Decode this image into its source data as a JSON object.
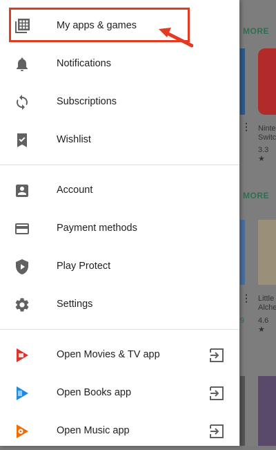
{
  "drawer": {
    "groups": [
      {
        "items": [
          {
            "label": "My apps & games",
            "icon": "apps-grid-icon"
          },
          {
            "label": "Notifications",
            "icon": "bell-icon"
          },
          {
            "label": "Subscriptions",
            "icon": "refresh-icon"
          },
          {
            "label": "Wishlist",
            "icon": "bookmark-check-icon"
          }
        ]
      },
      {
        "items": [
          {
            "label": "Account",
            "icon": "account-box-icon"
          },
          {
            "label": "Payment methods",
            "icon": "credit-card-icon"
          },
          {
            "label": "Play Protect",
            "icon": "shield-play-icon"
          },
          {
            "label": "Settings",
            "icon": "gear-icon"
          }
        ]
      },
      {
        "items": [
          {
            "label": "Open Movies & TV app",
            "icon": "play-movies-icon",
            "trailing_icon": "exit-to-app-icon"
          },
          {
            "label": "Open Books app",
            "icon": "play-books-icon",
            "trailing_icon": "exit-to-app-icon"
          },
          {
            "label": "Open Music app",
            "icon": "play-music-icon",
            "trailing_icon": "exit-to-app-icon"
          }
        ]
      }
    ]
  },
  "annotation": {
    "highlight_color": "#e43a22"
  },
  "background": {
    "more_label_1": "MORE",
    "more_label_2": "MORE",
    "card_1_title_a": "Ninte",
    "card_1_title_b": "Switc",
    "card_1_rating": "3.3 ★",
    "card_2_title_a": "Little",
    "card_2_title_b": "Alche",
    "card_2_rating": "4.6 ★",
    "card_2_left_digit": "9"
  },
  "colors": {
    "accent_green": "#2f6f52",
    "icon_gray": "#616161",
    "movies_red": "#e53935",
    "books_blue": "#1e88e5",
    "music_orange": "#ef6c00"
  }
}
